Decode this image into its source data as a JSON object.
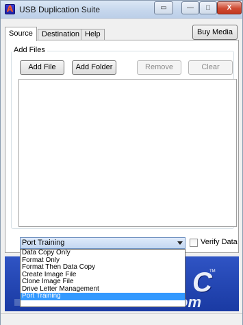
{
  "window": {
    "title": "USB Duplication Suite",
    "app_icon_letter": "A",
    "controls": {
      "restore": "▭",
      "minimize": "—",
      "maximize": "□",
      "close": "X"
    }
  },
  "tabs": [
    {
      "label": "Source",
      "active": true
    },
    {
      "label": "Destination",
      "active": false
    },
    {
      "label": "Help",
      "active": false
    }
  ],
  "buy_button": "Buy Media",
  "add_files": {
    "group_label": "Add Files",
    "buttons": {
      "add_file": "Add File",
      "add_folder": "Add Folder",
      "remove": "Remove",
      "clear": "Clear"
    }
  },
  "operation": {
    "selected": "Port Training",
    "options": [
      "Data Copy Only",
      "Format Only",
      "Format Then Data Copy",
      "Create Image File",
      "Clone Image File",
      "Drive Letter Management",
      "Port Training"
    ]
  },
  "verify": {
    "label": "Verify Data",
    "checked": false
  },
  "banner": {
    "letter": "C",
    "tm": "TM",
    "suffix": "om"
  },
  "colors": {
    "banner_blue": "#2f54c4",
    "selection_blue": "#3399ff",
    "close_red": "#cf4a32"
  }
}
